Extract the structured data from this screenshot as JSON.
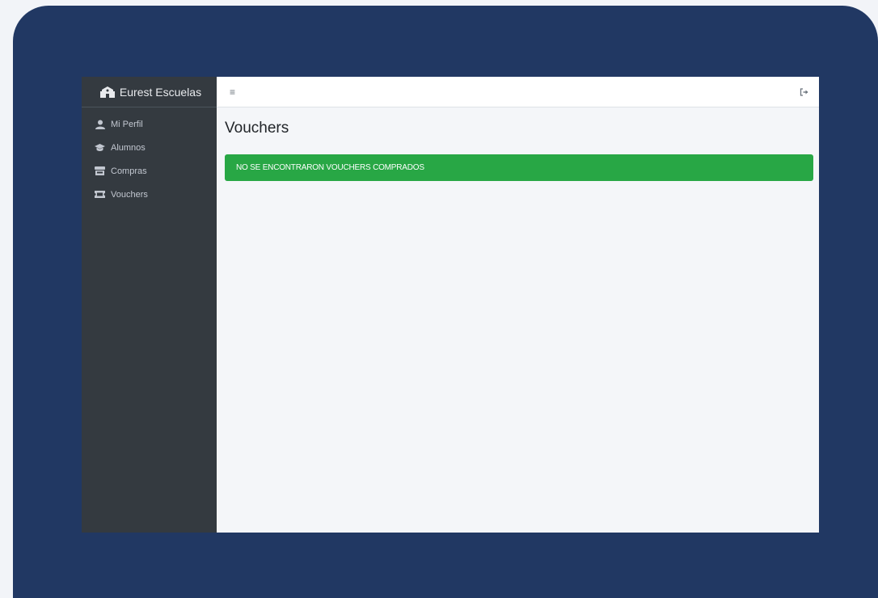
{
  "sidebar": {
    "brand": "Eurest Escuelas",
    "brand_icon": "school-icon",
    "items": [
      {
        "label": "Mi Perfil",
        "icon": "user-icon"
      },
      {
        "label": "Alumnos",
        "icon": "graduation-cap-icon"
      },
      {
        "label": "Compras",
        "icon": "store-icon"
      },
      {
        "label": "Vouchers",
        "icon": "ticket-icon"
      }
    ]
  },
  "topbar": {
    "menu_icon": "≡",
    "logout_icon": "sign-out-icon"
  },
  "main": {
    "title": "Vouchers",
    "alert": "NO SE ENCONTRARON VOUCHERS COMPRADOS"
  },
  "colors": {
    "frame": "#213863",
    "sidebar": "#343a40",
    "alert": "#28a745",
    "content_bg": "#f4f6f9"
  }
}
